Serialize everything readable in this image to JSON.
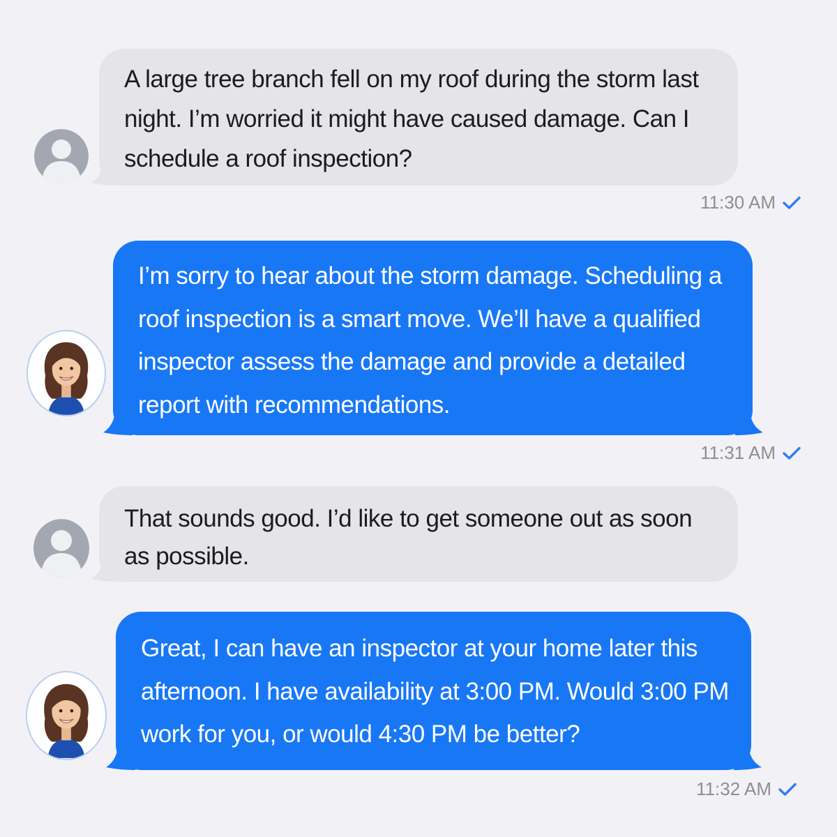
{
  "conversation": {
    "messages": [
      {
        "sender": "customer",
        "avatar_icon": "default-user-icon",
        "text": "A large tree branch fell on my roof during the storm last night. I’m worried it might have caused damage. Can I schedule a roof inspection?",
        "time": "11:30 AM",
        "status_icon": "checkmark-icon"
      },
      {
        "sender": "agent",
        "avatar_icon": "agent-photo-icon",
        "text": "I’m sorry to hear about the storm damage. Scheduling a roof inspection is a smart move. We’ll have a qualified inspector assess the damage and provide a detailed report with recommendations.",
        "time": "11:31 AM",
        "status_icon": "checkmark-icon"
      },
      {
        "sender": "customer",
        "avatar_icon": "default-user-icon",
        "text": "That sounds good. I’d like to get someone out as soon as possible.",
        "time": "",
        "status_icon": ""
      },
      {
        "sender": "agent",
        "avatar_icon": "agent-photo-icon",
        "text": "Great, I can have an inspector at your home later this afternoon. I have availability at 3:00 PM. Would 3:00 PM work for you, or would 4:30 PM be better?",
        "time": "11:32 AM",
        "status_icon": "checkmark-icon"
      }
    ]
  },
  "colors": {
    "background": "#f2f1f5",
    "user_bubble": "#e4e4e9",
    "agent_bubble": "#1877f5",
    "timestamp": "#8e8e93",
    "checkmark": "#2f7bf6"
  }
}
